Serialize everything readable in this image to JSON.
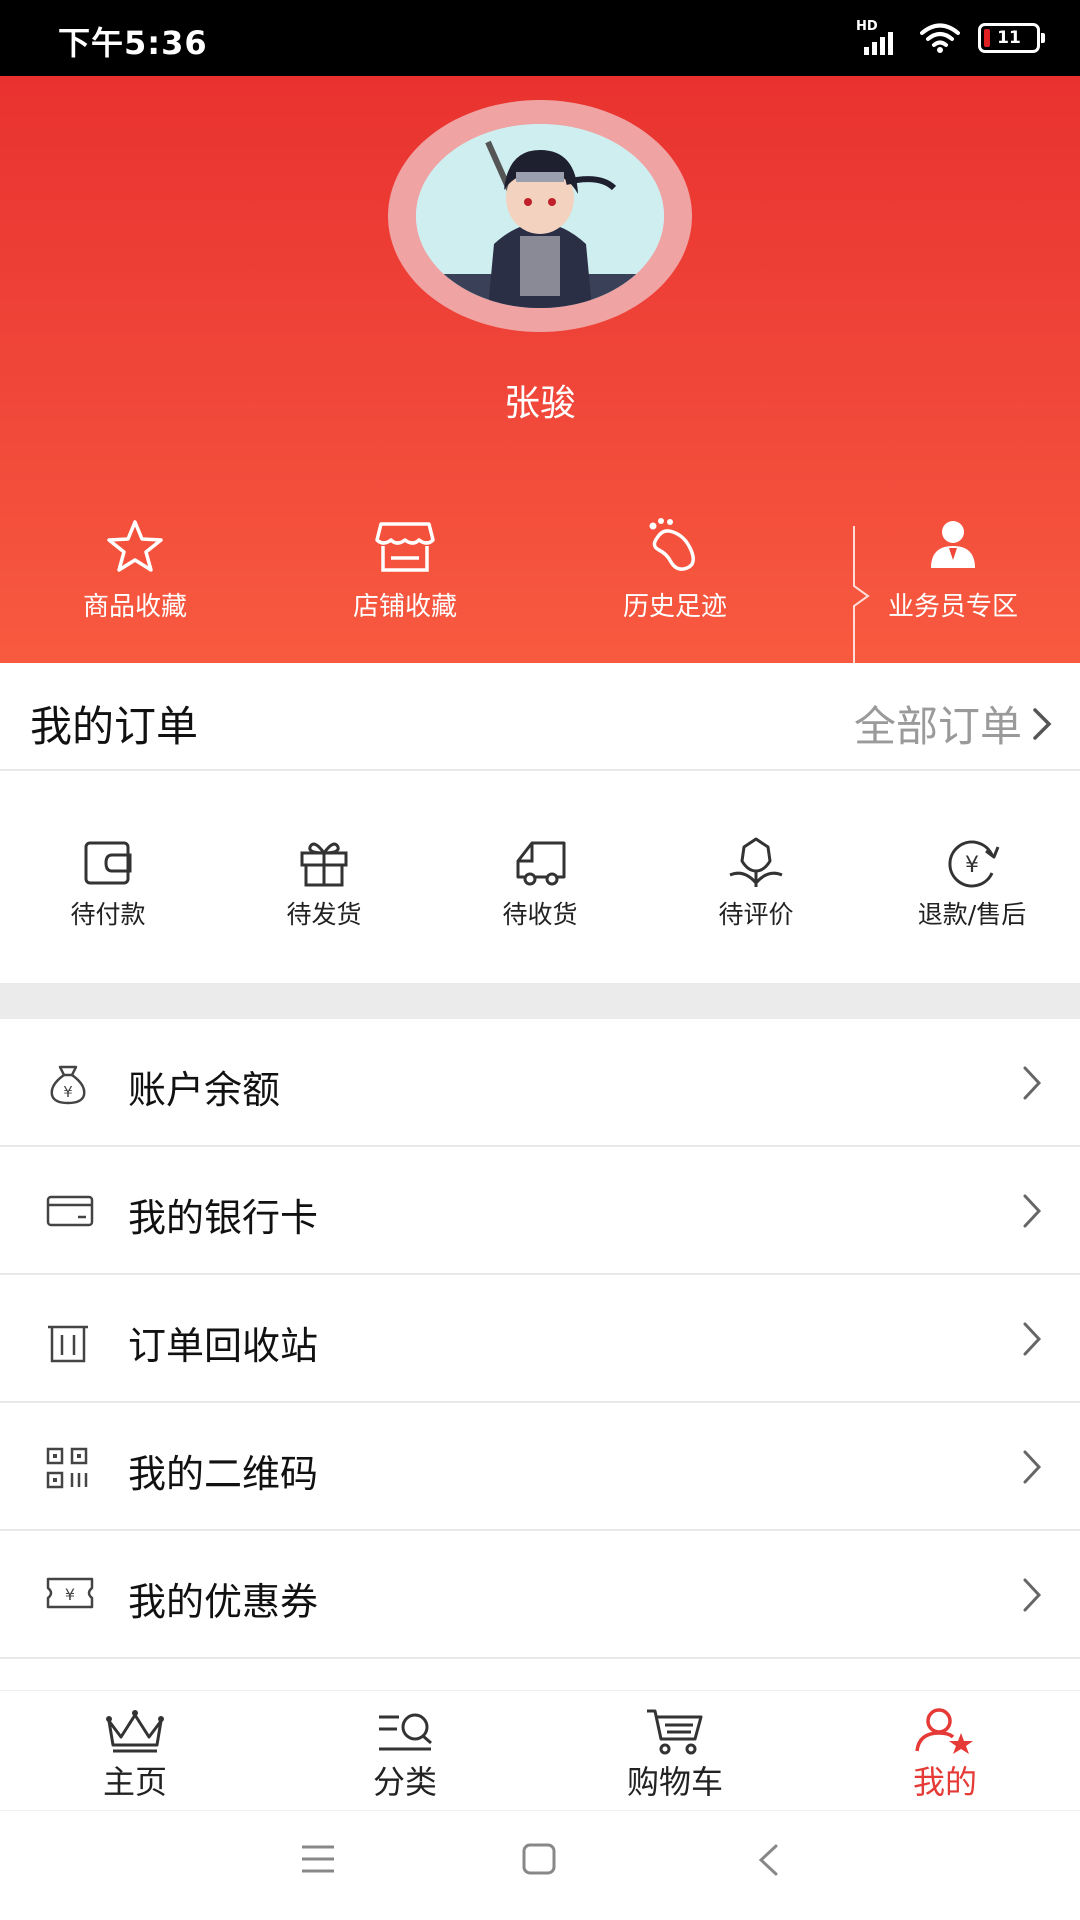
{
  "status_bar": {
    "time": "下午5:36",
    "network": "HD",
    "battery": "11"
  },
  "profile": {
    "username": "张骏"
  },
  "quick_links": [
    {
      "label": "商品收藏",
      "icon": "star-icon"
    },
    {
      "label": "店铺收藏",
      "icon": "store-icon"
    },
    {
      "label": "历史足迹",
      "icon": "footprint-icon"
    },
    {
      "label": "业务员专区",
      "icon": "salesperson-icon"
    }
  ],
  "orders": {
    "title": "我的订单",
    "all_label": "全部订单",
    "statuses": [
      {
        "label": "待付款",
        "icon": "wallet-icon"
      },
      {
        "label": "待发货",
        "icon": "gift-icon"
      },
      {
        "label": "待收货",
        "icon": "truck-icon"
      },
      {
        "label": "待评价",
        "icon": "flower-icon"
      },
      {
        "label": "退款/售后",
        "icon": "refund-icon"
      }
    ]
  },
  "menu": [
    {
      "label": "账户余额",
      "icon": "money-bag-icon"
    },
    {
      "label": "我的银行卡",
      "icon": "bank-card-icon"
    },
    {
      "label": "订单回收站",
      "icon": "trash-icon"
    },
    {
      "label": "我的二维码",
      "icon": "qr-code-icon"
    },
    {
      "label": "我的优惠券",
      "icon": "coupon-icon"
    }
  ],
  "tabs": [
    {
      "label": "主页",
      "icon": "crown-icon",
      "active": false
    },
    {
      "label": "分类",
      "icon": "category-search-icon",
      "active": false
    },
    {
      "label": "购物车",
      "icon": "cart-icon",
      "active": false
    },
    {
      "label": "我的",
      "icon": "user-star-icon",
      "active": true
    }
  ],
  "colors": {
    "brand_red": "#e53a36",
    "header_top": "#e9322f",
    "header_bottom": "#f85a3f",
    "muted_text": "#9a9a9a"
  }
}
